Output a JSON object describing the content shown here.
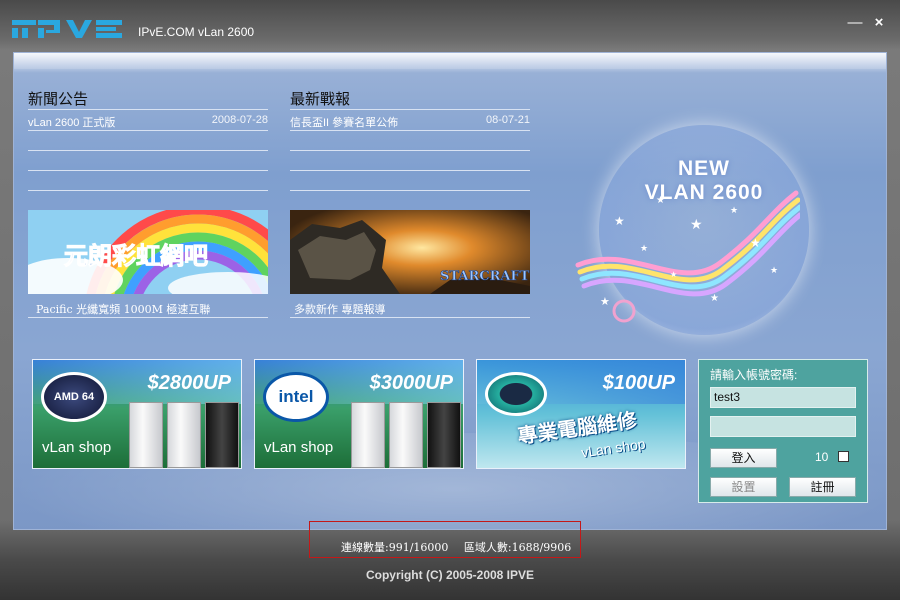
{
  "app": {
    "title": "IPvE.COM vLan 2600",
    "logo_text": "IPVE",
    "minimize_glyph": "—",
    "close_glyph": "×"
  },
  "news": {
    "title": "新聞公告",
    "items": [
      {
        "text": "vLan 2600 正式版",
        "date": "2008-07-28"
      }
    ]
  },
  "battle": {
    "title": "最新戰報",
    "items": [
      {
        "text": "信長盃II 參賽名單公佈",
        "date": "08-07-21"
      }
    ]
  },
  "thumbs": [
    {
      "image_text": "元朗彩虹網吧",
      "caption": "Pacific 光纖寬頻 1000M 極速互聯"
    },
    {
      "image_text": "STARCRAFT",
      "caption": "多款新作  專題報導"
    }
  ],
  "hero": {
    "line1": "NEW",
    "line2": "VLAN 2600"
  },
  "banners": [
    {
      "price": "$2800UP",
      "shop": "vLan shop",
      "badge": "AMD 64"
    },
    {
      "price": "$3000UP",
      "shop": "vLan shop",
      "badge": "intel"
    },
    {
      "price": "$100UP",
      "shop": "vLan shop",
      "service": "專業電腦維修"
    }
  ],
  "login": {
    "label": "請輸入帳號密碼:",
    "username": "test3",
    "password": "",
    "login_button": "登入",
    "count": "10",
    "settings_button": "設置",
    "register_button": "註冊"
  },
  "status": {
    "connections": "連線數量:991/16000",
    "users": "區域人數:1688/9906"
  },
  "footer": {
    "copyright": "Copyright (C) 2005-2008 IPVE"
  },
  "colors": {
    "panel_blue": "#7f9fcf",
    "login_green": "#4ea39f",
    "status_border": "#c41818"
  }
}
